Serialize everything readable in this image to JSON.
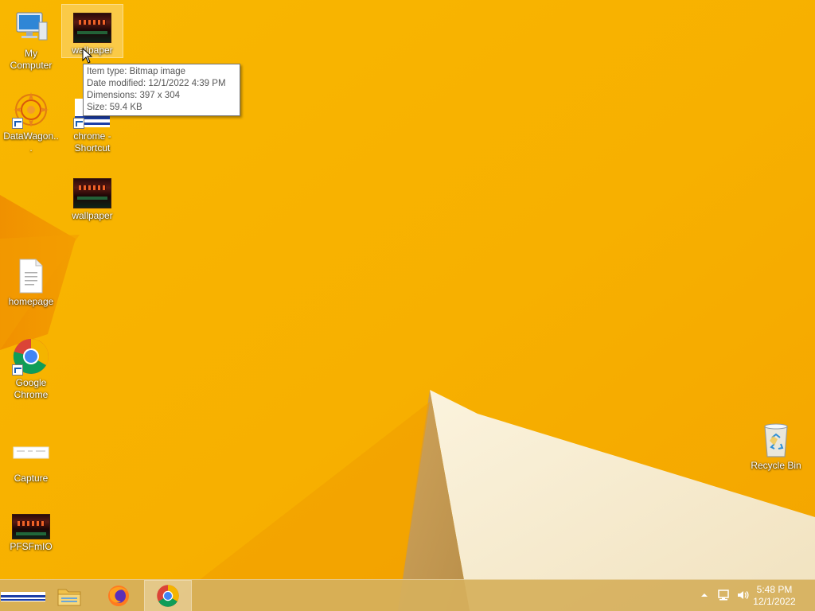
{
  "desktop": {
    "background_color": "#f7b300",
    "icons": [
      {
        "label": "My Computer",
        "icon": "computer-icon"
      },
      {
        "label": "wallpaper",
        "icon": "bitmap-thumbnail-icon",
        "selected": true
      },
      {
        "label": "DataWagon...",
        "icon": "datawagon-icon",
        "shortcut": true
      },
      {
        "label": "chrome - Shortcut",
        "icon": "image-shortcut-icon",
        "shortcut": true
      },
      {
        "label": "wallpaper",
        "icon": "bitmap-thumbnail-icon"
      },
      {
        "label": "homepage",
        "icon": "text-document-icon"
      },
      {
        "label": "Google Chrome",
        "icon": "chrome-icon",
        "shortcut": true
      },
      {
        "label": "Capture",
        "icon": "image-thumbnail-icon"
      },
      {
        "label": "PFSFmIO",
        "icon": "bitmap-thumbnail-icon"
      },
      {
        "label": "Recycle Bin",
        "icon": "recycle-bin-icon"
      }
    ]
  },
  "tooltip": {
    "lines": [
      "Item type: Bitmap image",
      "Date modified: 12/1/2022 4:39 PM",
      "Dimensions: 397 x 304",
      "Size: 59.4 KB"
    ]
  },
  "taskbar": {
    "buttons": [
      {
        "name": "start-preview",
        "icon": "app-window-icon"
      },
      {
        "name": "file-explorer",
        "icon": "folder-icon"
      },
      {
        "name": "firefox",
        "icon": "firefox-icon"
      },
      {
        "name": "chrome",
        "icon": "chrome-icon",
        "active": true
      }
    ],
    "tray": {
      "icons": [
        "show-hidden-icons-chevron",
        "network-icon",
        "volume-icon"
      ]
    },
    "clock": {
      "time": "5:48 PM",
      "date": "12/1/2022"
    }
  }
}
